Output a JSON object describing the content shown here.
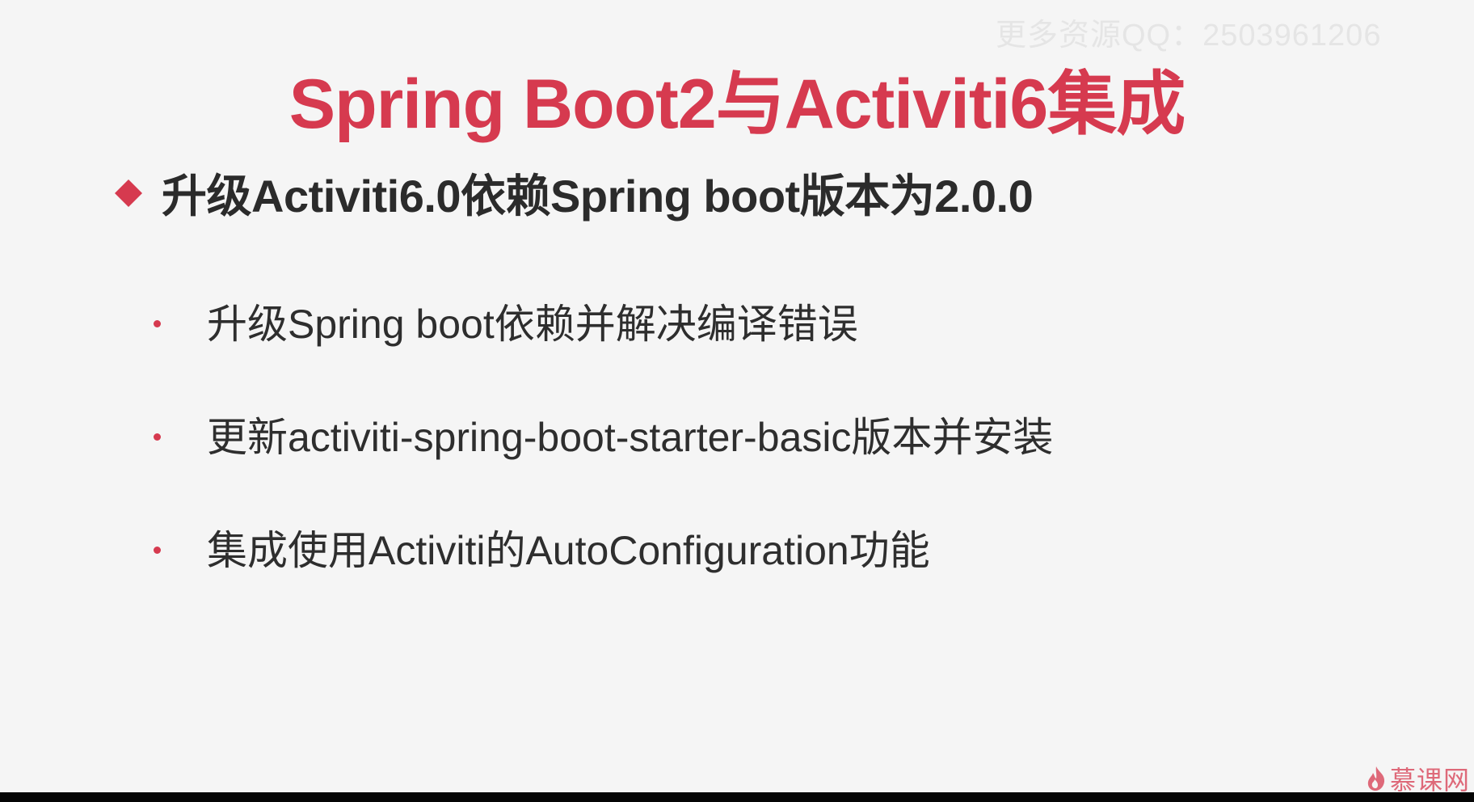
{
  "watermark": {
    "text": "更多资源QQ：2503961206"
  },
  "slide": {
    "title": "Spring Boot2与Activiti6集成",
    "heading": "升级Activiti6.0依赖Spring boot版本为2.0.0",
    "bullets": [
      "升级Spring boot依赖并解决编译错误",
      "更新activiti-spring-boot-starter-basic版本并安装",
      "集成使用Activiti的AutoConfiguration功能"
    ]
  },
  "logo": {
    "text": "慕课网"
  },
  "colors": {
    "accent": "#d63a4f",
    "text": "#2e2e2e",
    "background": "#f5f5f5"
  },
  "icons": {
    "heading_marker": "diamond-icon",
    "bullet_marker": "dot-icon",
    "logo_mark": "flame-icon"
  }
}
